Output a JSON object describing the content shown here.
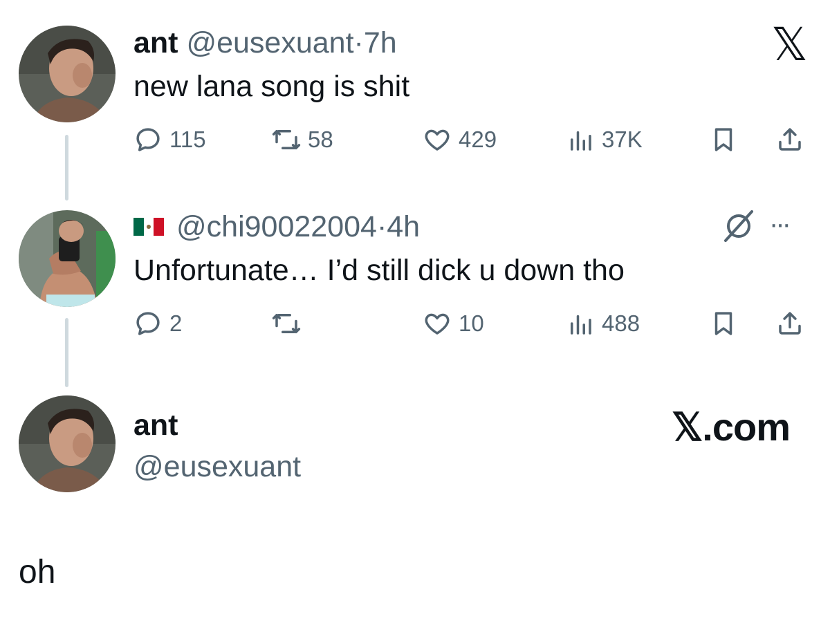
{
  "tweet1": {
    "name": "ant",
    "handle": "@eusexuant",
    "separator": "·",
    "time": "7h",
    "text": "new lana song is shit",
    "replies": "115",
    "reposts": "58",
    "likes": "429",
    "views": "37K",
    "corner_logo": "𝕏"
  },
  "tweet2": {
    "flag_icon": "mexico-flag-icon",
    "handle": "@chi90022004",
    "separator": "·",
    "time": "4h",
    "text": "Unfortunate… I’d still dick u down tho",
    "replies": "2",
    "reposts": "",
    "likes": "10",
    "views": "488",
    "more": "···"
  },
  "card": {
    "name": "ant",
    "handle": "@eusexuant",
    "brand": "𝕏.com"
  },
  "caption": "oh",
  "colors": {
    "text": "#0f1419",
    "muted": "#536471",
    "thread_line": "#cfd9de"
  }
}
